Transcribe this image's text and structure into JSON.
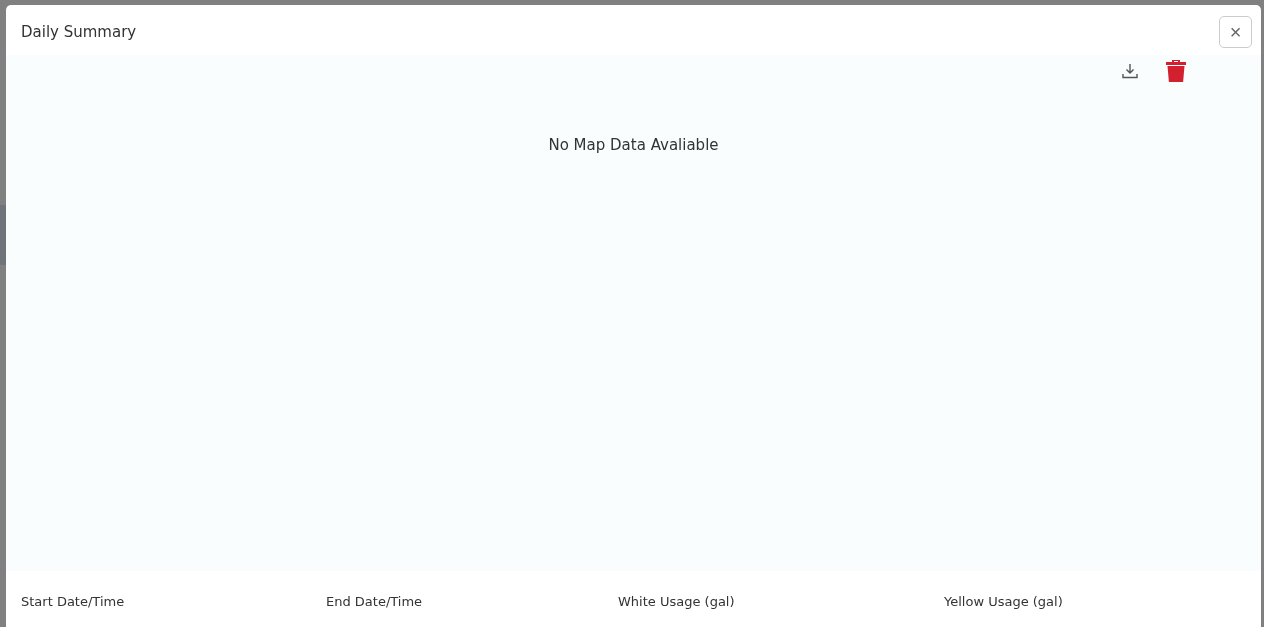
{
  "dialog": {
    "title": "Daily Summary",
    "close": "×"
  },
  "map": {
    "message": "No Map Data Avaliable"
  },
  "table": {
    "columns": [
      "Start Date/Time",
      "End Date/Time",
      "White Usage (gal)",
      "Yellow Usage (gal)"
    ]
  }
}
